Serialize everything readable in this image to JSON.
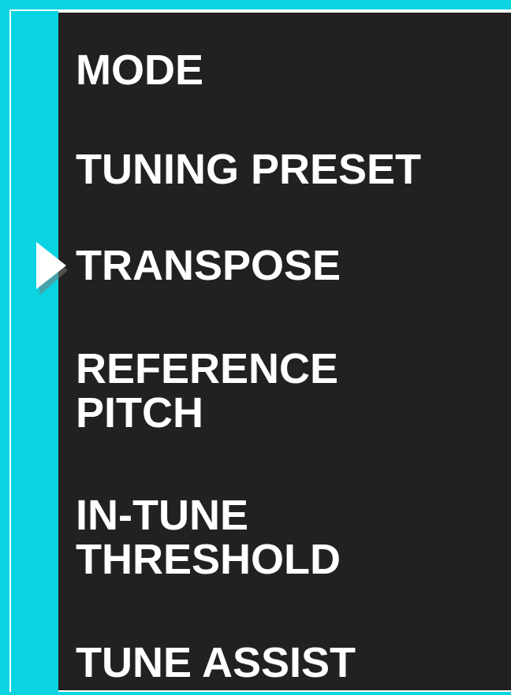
{
  "colors": {
    "accent": "#0ad3e2",
    "panel_background": "#232021",
    "text": "#ffffff"
  },
  "menu": {
    "items": [
      {
        "label": "MODE"
      },
      {
        "label": "TUNING PRESET"
      },
      {
        "label": "TRANSPOSE",
        "selected": true
      },
      {
        "label": "REFERENCE\nPITCH"
      },
      {
        "label": "IN-TUNE\nTHRESHOLD"
      },
      {
        "label": "TUNE ASSIST"
      }
    ],
    "selected_icon": "right-triangle-selector-icon"
  }
}
